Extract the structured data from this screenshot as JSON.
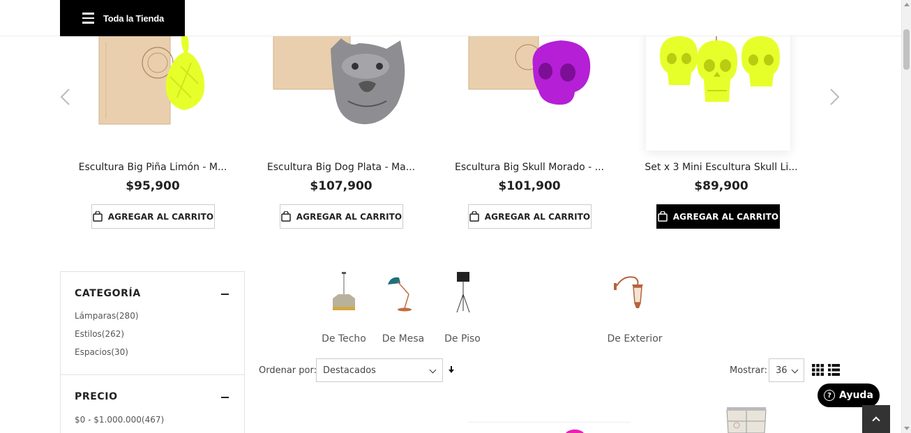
{
  "header": {
    "store_button_label": "Toda la Tienda"
  },
  "carousel": {
    "products": [
      {
        "name": "Escultura Big Piña Limón - M...",
        "price": "$95,900",
        "cart_label": "AGREGAR AL CARRITO"
      },
      {
        "name": "Escultura Big Dog Plata - Ma...",
        "price": "$107,900",
        "cart_label": "AGREGAR AL CARRITO"
      },
      {
        "name": "Escultura Big Skull Morado - ...",
        "price": "$101,900",
        "cart_label": "AGREGAR AL CARRITO"
      },
      {
        "name": "Set x 3 Mini Escultura Skull Li...",
        "price": "$89,900",
        "cart_label": "AGREGAR AL CARRITO"
      }
    ]
  },
  "sidebar": {
    "category": {
      "title": "CATEGORÍA",
      "items": [
        "Lámparas(280)",
        "Estilos(262)",
        "Espacios(30)"
      ]
    },
    "price": {
      "title": "PRECIO",
      "items": [
        "$0 - $1.000.000(467)"
      ]
    }
  },
  "categories": [
    {
      "label": "De Techo",
      "icon": "ceiling-lamp-icon"
    },
    {
      "label": "De Mesa",
      "icon": "desk-lamp-icon"
    },
    {
      "label": "De Piso",
      "icon": "floor-lamp-icon"
    },
    {
      "label": "De Exterior",
      "icon": "outdoor-lamp-icon"
    }
  ],
  "toolbar": {
    "sort_label": "Ordenar por:",
    "sort_value": "Destacados",
    "show_label": "Mostrar:",
    "show_value": "36"
  },
  "help": {
    "label": "Ayuda"
  },
  "colors": {
    "black": "#000000",
    "lime": "#e6ff2a",
    "purple": "#b51fd6",
    "silver": "#8e8e92",
    "wood": "#e8c9a6"
  }
}
